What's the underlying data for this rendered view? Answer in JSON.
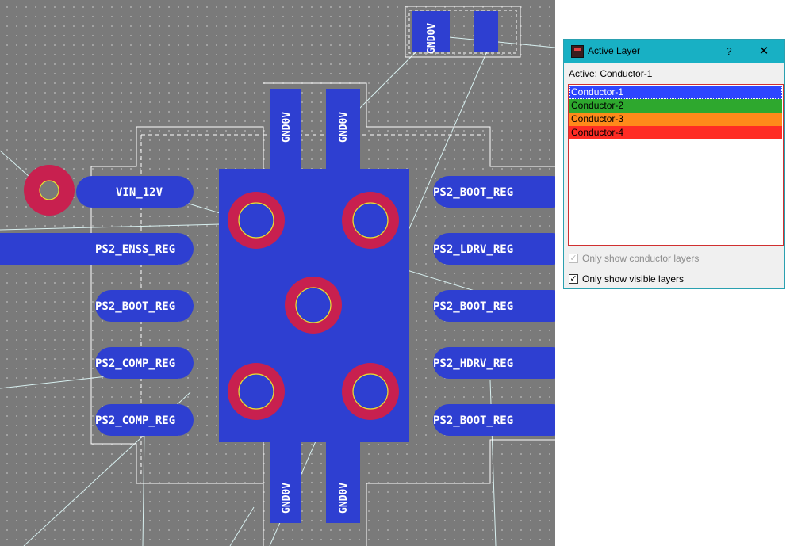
{
  "board": {
    "pads_left": [
      "VIN_12V",
      "PS2_ENSS_REG",
      "PS2_BOOT_REG",
      "PS2_COMP_REG",
      "PS2_COMP_REG"
    ],
    "pads_right": [
      "PS2_BOOT_REG",
      "PS2_LDRV_REG",
      "PS2_BOOT_REG",
      "PS2_HDRV_REG",
      "PS2_BOOT_REG"
    ],
    "gnd_label": "GND0V",
    "colors": {
      "conductor": "#2e3fd1",
      "via": "#c8204f",
      "via_ring": "#e8e030",
      "background": "#7a7a7a",
      "outline": "#ffffff",
      "ratsnest": "#d8f0f0"
    }
  },
  "dialog": {
    "title": "Active Layer",
    "help": "?",
    "close": "✕",
    "active_text": "Active: Conductor-1",
    "layers": [
      {
        "label": "Conductor-1",
        "color": "#2d45ff"
      },
      {
        "label": "Conductor-2",
        "color": "#2ea82e"
      },
      {
        "label": "Conductor-3",
        "color": "#ff8a1a"
      },
      {
        "label": "Conductor-4",
        "color": "#ff2c24"
      }
    ],
    "only_conductor": "Only show conductor layers",
    "only_visible": "Only show visible layers"
  }
}
